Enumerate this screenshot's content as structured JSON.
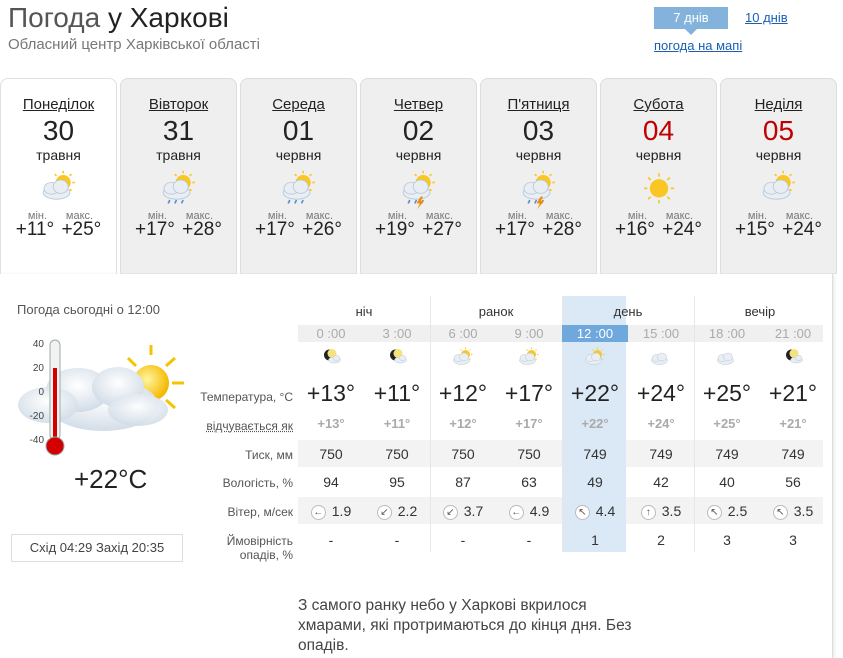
{
  "header": {
    "title_prefix": "Погода",
    "title_city": "у Харкові",
    "subtitle": "Обласний центр Харківської області",
    "tab_7": "7 днів",
    "tab_10": "10 днів",
    "map_link": "погода на мапі"
  },
  "minmax": {
    "min": "мін.",
    "max": "макс."
  },
  "days": [
    {
      "name": "Понеділок",
      "num": "30",
      "month": "травня",
      "min": "+11°",
      "max": "+25°",
      "icon": "sun-cloud-icon",
      "weekend": false,
      "active": true
    },
    {
      "name": "Вівторок",
      "num": "31",
      "month": "травня",
      "min": "+17°",
      "max": "+28°",
      "icon": "sun-cloud-rain-icon",
      "weekend": false,
      "active": false
    },
    {
      "name": "Середа",
      "num": "01",
      "month": "червня",
      "min": "+17°",
      "max": "+26°",
      "icon": "sun-cloud-rain-icon",
      "weekend": false,
      "active": false
    },
    {
      "name": "Четвер",
      "num": "02",
      "month": "червня",
      "min": "+19°",
      "max": "+27°",
      "icon": "sun-cloud-storm-icon",
      "weekend": false,
      "active": false
    },
    {
      "name": "П'ятниця",
      "num": "03",
      "month": "червня",
      "min": "+17°",
      "max": "+28°",
      "icon": "sun-cloud-storm-icon",
      "weekend": false,
      "active": false
    },
    {
      "name": "Субота",
      "num": "04",
      "month": "червня",
      "min": "+16°",
      "max": "+24°",
      "icon": "sun-icon",
      "weekend": true,
      "active": false
    },
    {
      "name": "Неділя",
      "num": "05",
      "month": "червня",
      "min": "+15°",
      "max": "+24°",
      "icon": "sun-cloud-icon",
      "weekend": true,
      "active": false
    }
  ],
  "today": {
    "label": "Погода сьогодні о 12:00",
    "temp": "+22°C",
    "scale": [
      "40",
      "20",
      "0",
      "-20",
      "-40"
    ],
    "sunrise_label": "Схід",
    "sunrise": "04:29",
    "sunset_label": "Захід",
    "sunset": "20:35"
  },
  "periods": [
    "ніч",
    "ранок",
    "день",
    "вечір"
  ],
  "row_labels": {
    "temperature": "Температура, °C",
    "feels": "відчувається як",
    "pressure": "Тиск, мм",
    "humidity": "Вологість, %",
    "wind": "Вітер, м/сек",
    "precip_1": "Ймовірність",
    "precip_2": "опадів, %"
  },
  "hours": [
    {
      "time": "0 :00",
      "icon": "moon-cloud-icon",
      "temp": "+13°",
      "feel": "+13°",
      "pressure": "750",
      "humidity": "94",
      "wind_dir": "←",
      "wind": "1.9",
      "precip": "-"
    },
    {
      "time": "3 :00",
      "icon": "moon-cloud-icon",
      "temp": "+11°",
      "feel": "+11°",
      "pressure": "750",
      "humidity": "95",
      "wind_dir": "↙",
      "wind": "2.2",
      "precip": "-"
    },
    {
      "time": "6 :00",
      "icon": "sun-cloud-icon",
      "temp": "+12°",
      "feel": "+12°",
      "pressure": "750",
      "humidity": "87",
      "wind_dir": "↙",
      "wind": "3.7",
      "precip": "-"
    },
    {
      "time": "9 :00",
      "icon": "sun-cloud-icon",
      "temp": "+17°",
      "feel": "+17°",
      "pressure": "750",
      "humidity": "63",
      "wind_dir": "←",
      "wind": "4.9",
      "precip": "-"
    },
    {
      "time": "12 :00",
      "icon": "sun-cloud-icon",
      "temp": "+22°",
      "feel": "+22°",
      "pressure": "749",
      "humidity": "49",
      "wind_dir": "↖",
      "wind": "4.4",
      "precip": "1"
    },
    {
      "time": "15 :00",
      "icon": "cloud-icon",
      "temp": "+24°",
      "feel": "+24°",
      "pressure": "749",
      "humidity": "42",
      "wind_dir": "↑",
      "wind": "3.5",
      "precip": "2"
    },
    {
      "time": "18 :00",
      "icon": "cloud-icon",
      "temp": "+25°",
      "feel": "+25°",
      "pressure": "749",
      "humidity": "40",
      "wind_dir": "↖",
      "wind": "2.5",
      "precip": "3"
    },
    {
      "time": "21 :00",
      "icon": "moon-cloud-icon",
      "temp": "+21°",
      "feel": "+21°",
      "pressure": "749",
      "humidity": "56",
      "wind_dir": "↖",
      "wind": "3.5",
      "precip": "3"
    }
  ],
  "description": "З самого ранку небо у Харкові вкрилося хмарами, які протримаються до кінця дня. Без опадів.",
  "colors": {
    "accent": "#83b3dc",
    "current_hour": "#6fa8dc",
    "highlight_col": "#dbe9f6",
    "weekend": "#c00000"
  }
}
